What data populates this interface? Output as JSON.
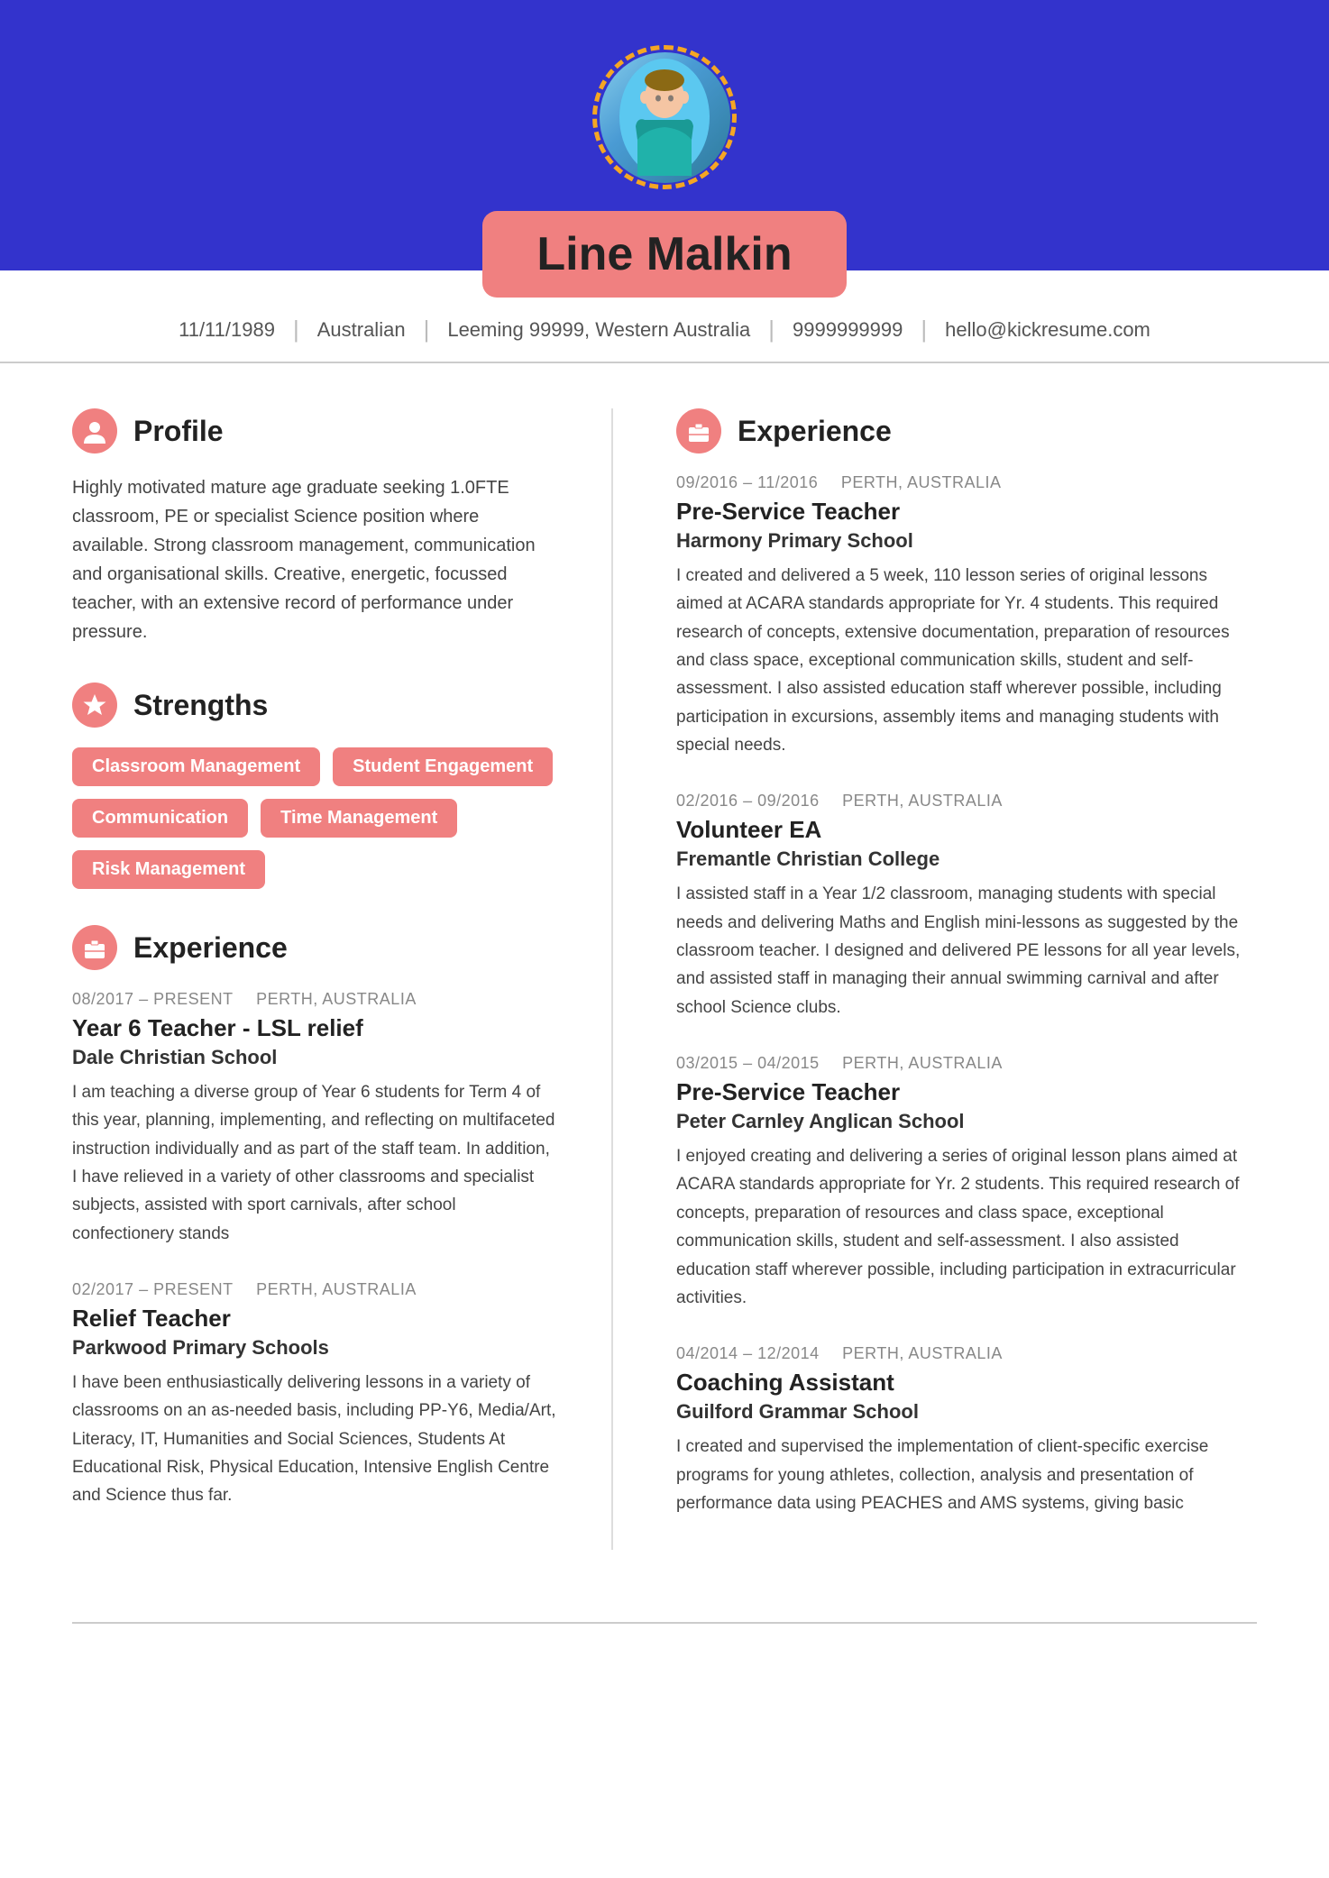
{
  "header": {
    "name": "Line Malkin",
    "avatar_alt": "Profile photo of Line Malkin"
  },
  "contact": {
    "dob": "11/11/1989",
    "nationality": "Australian",
    "address": "Leeming 99999, Western Australia",
    "phone": "9999999999",
    "email": "hello@kickresume.com"
  },
  "profile": {
    "section_label": "Profile",
    "body": "Highly motivated mature age graduate seeking 1.0FTE classroom, PE or specialist Science position where available. Strong classroom management, communication and organisational skills. Creative, energetic, focussed teacher, with an extensive record of performance under pressure."
  },
  "strengths": {
    "section_label": "Strengths",
    "tags": [
      "Classroom Management",
      "Student Engagement",
      "Communication",
      "Time Management",
      "Risk Management"
    ]
  },
  "left_experience": {
    "section_label": "Experience",
    "entries": [
      {
        "dates": "08/2017 – PRESENT",
        "location": "PERTH, AUSTRALIA",
        "title": "Year 6 Teacher - LSL relief",
        "company": "Dale Christian School",
        "desc": "I am teaching a diverse group of Year 6 students for Term 4 of this year, planning, implementing, and reflecting on multifaceted instruction individually and as part of the staff team. In addition, I have relieved in a variety of other classrooms and specialist subjects, assisted with sport carnivals, after school confectionery stands"
      },
      {
        "dates": "02/2017 – PRESENT",
        "location": "PERTH, AUSTRALIA",
        "title": "Relief Teacher",
        "company": "Parkwood Primary Schools",
        "desc": "I have been enthusiastically delivering lessons in a variety of classrooms on an as-needed basis, including PP-Y6, Media/Art, Literacy, IT, Humanities and Social Sciences, Students At Educational Risk, Physical Education, Intensive English Centre and Science thus far."
      }
    ]
  },
  "right_experience": {
    "section_label": "Experience",
    "entries": [
      {
        "dates": "09/2016 – 11/2016",
        "location": "PERTH, AUSTRALIA",
        "title": "Pre-Service Teacher",
        "company": "Harmony Primary School",
        "desc": "I created and delivered a 5 week, 110 lesson series of original lessons aimed at ACARA standards appropriate for Yr. 4 students. This required research of concepts, extensive documentation, preparation of resources and class space, exceptional communication skills, student and self-assessment. I also assisted education staff wherever possible, including participation in excursions, assembly items and managing students with special needs."
      },
      {
        "dates": "02/2016 – 09/2016",
        "location": "PERTH, AUSTRALIA",
        "title": "Volunteer EA",
        "company": "Fremantle Christian College",
        "desc": "I assisted staff in a Year 1/2 classroom, managing students with special needs and delivering Maths and English mini-lessons as suggested by the classroom teacher. I designed and delivered PE lessons for all year levels, and assisted staff in managing their annual swimming carnival and after school Science clubs."
      },
      {
        "dates": "03/2015 – 04/2015",
        "location": "PERTH, AUSTRALIA",
        "title": "Pre-Service Teacher",
        "company": "Peter Carnley Anglican School",
        "desc": "I enjoyed creating and delivering a series of original lesson plans aimed at ACARA standards appropriate for Yr. 2 students. This required research of concepts, preparation of resources and class space, exceptional communication skills, student and self-assessment. I also assisted education staff wherever possible, including participation in extracurricular activities."
      },
      {
        "dates": "04/2014 – 12/2014",
        "location": "PERTH, AUSTRALIA",
        "title": "Coaching Assistant",
        "company": "Guilford Grammar School",
        "desc": "I created and supervised the implementation of client-specific exercise programs for young athletes, collection, analysis and presentation of performance data using PEACHES and AMS systems, giving basic"
      }
    ]
  },
  "icons": {
    "profile": "👤",
    "strengths": "⭐",
    "experience": "🗂️"
  }
}
